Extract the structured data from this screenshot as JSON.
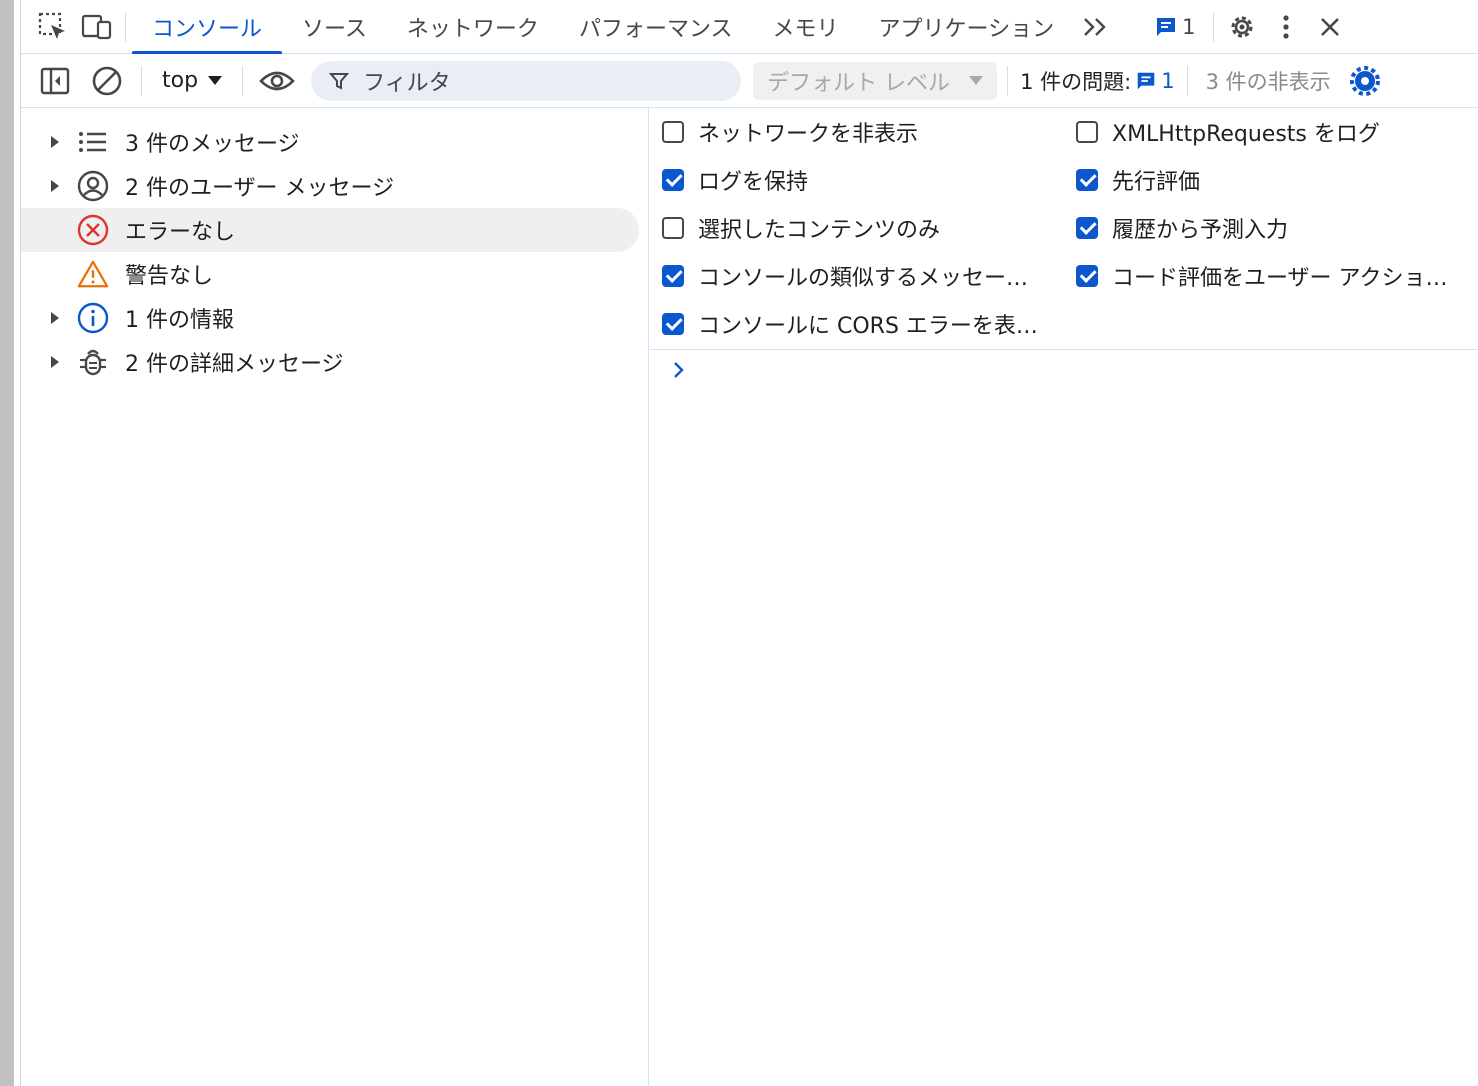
{
  "tabs": [
    {
      "label": "コンソール",
      "active": true
    },
    {
      "label": "ソース"
    },
    {
      "label": "ネットワーク"
    },
    {
      "label": "パフォーマンス"
    },
    {
      "label": "メモリ"
    },
    {
      "label": "アプリケーション"
    }
  ],
  "tabbar": {
    "issues_count": "1"
  },
  "toolbar": {
    "context": "top",
    "filter_placeholder": "フィルタ",
    "level": "デフォルト レベル",
    "issues_label": "1 件の問題:",
    "issues_count": "1",
    "hidden": "3 件の非表示"
  },
  "sidebar": {
    "items": [
      {
        "label": "3 件のメッセージ",
        "icon": "list-icon"
      },
      {
        "label": "2 件のユーザー メッセージ",
        "icon": "user-icon"
      },
      {
        "label": "エラーなし",
        "icon": "error-icon"
      },
      {
        "label": "警告なし",
        "icon": "warning-icon"
      },
      {
        "label": "1 件の情報",
        "icon": "info-icon"
      },
      {
        "label": "2 件の詳細メッセージ",
        "icon": "bug-icon"
      }
    ]
  },
  "settings": {
    "options": [
      {
        "label": "ネットワークを非表示",
        "checked": false
      },
      {
        "label": "XMLHttpRequests をログ",
        "checked": false
      },
      {
        "label": "ログを保持",
        "checked": true
      },
      {
        "label": "先行評価",
        "checked": true
      },
      {
        "label": "選択したコンテンツのみ",
        "checked": false
      },
      {
        "label": "履歴から予測入力",
        "checked": true
      },
      {
        "label": "コンソールの類似するメッセー…",
        "checked": true
      },
      {
        "label": "コード評価をユーザー アクショ…",
        "checked": true
      },
      {
        "label": "コンソールに CORS エラーを表…",
        "checked": true
      }
    ]
  },
  "colors": {
    "accent": "#0b57d0",
    "error": "#dc362e",
    "warning": "#e8710a"
  }
}
